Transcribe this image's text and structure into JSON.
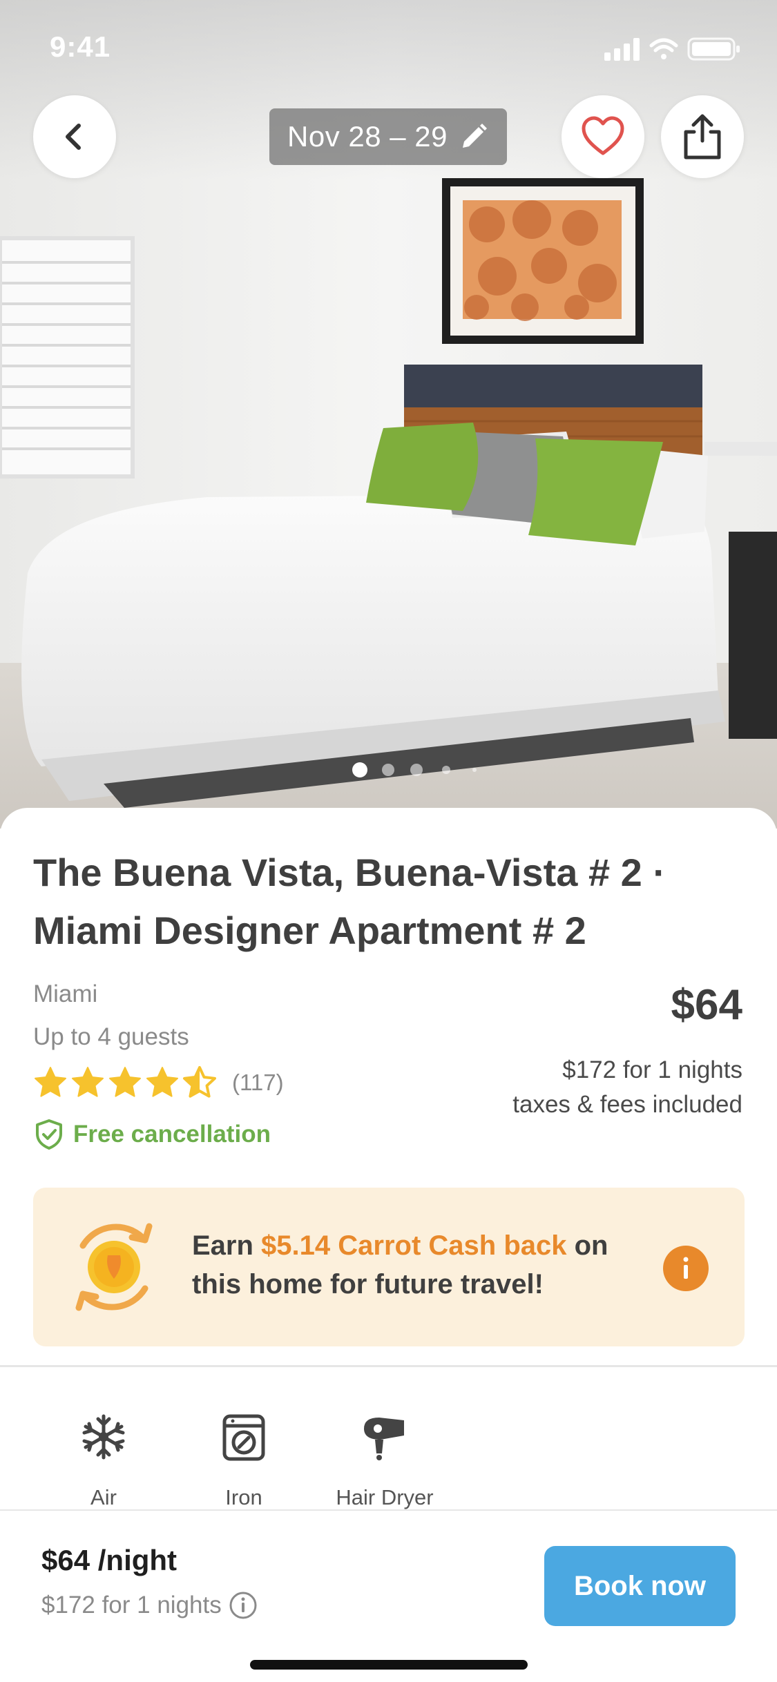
{
  "status_bar": {
    "time": "9:41"
  },
  "header": {
    "dates": "Nov 28 – 29",
    "back_icon": "chevron-left-icon",
    "edit_icon": "pencil-icon",
    "favorite_icon": "heart-icon",
    "share_icon": "share-icon"
  },
  "gallery": {
    "total_images": 5,
    "current_index": 1
  },
  "listing": {
    "title": "The Buena Vista, Buena-Vista # 2 · Miami Designer Apartment # 2",
    "city": "Miami",
    "guests": "Up to 4 guests",
    "rating": 4.5,
    "review_count": "(117)",
    "free_cancellation": "Free cancellation",
    "price": "$64",
    "total_price": "$172 for 1 nights",
    "taxes_note": "taxes & fees included"
  },
  "promo": {
    "prefix": "Earn ",
    "highlight": "$5.14 Carrot Cash back",
    "suffix": " on this home for future travel!",
    "icon": "coin-cashback-icon",
    "info_icon": "info-icon"
  },
  "amenities": [
    {
      "label": "Air",
      "icon": "snowflake-icon"
    },
    {
      "label": "Iron",
      "icon": "iron-icon"
    },
    {
      "label": "Hair Dryer",
      "icon": "hair-dryer-icon"
    }
  ],
  "bottom_bar": {
    "night_price": "$64 /night",
    "total": "$172 for 1 nights",
    "book_label": "Book now"
  },
  "colors": {
    "accent_green": "#6cad4b",
    "accent_orange": "#e8892b",
    "promo_bg": "#fcf0dc",
    "button_blue": "#4ba8e1",
    "heart_red": "#e0534e",
    "star_yellow": "#f6c22d"
  }
}
